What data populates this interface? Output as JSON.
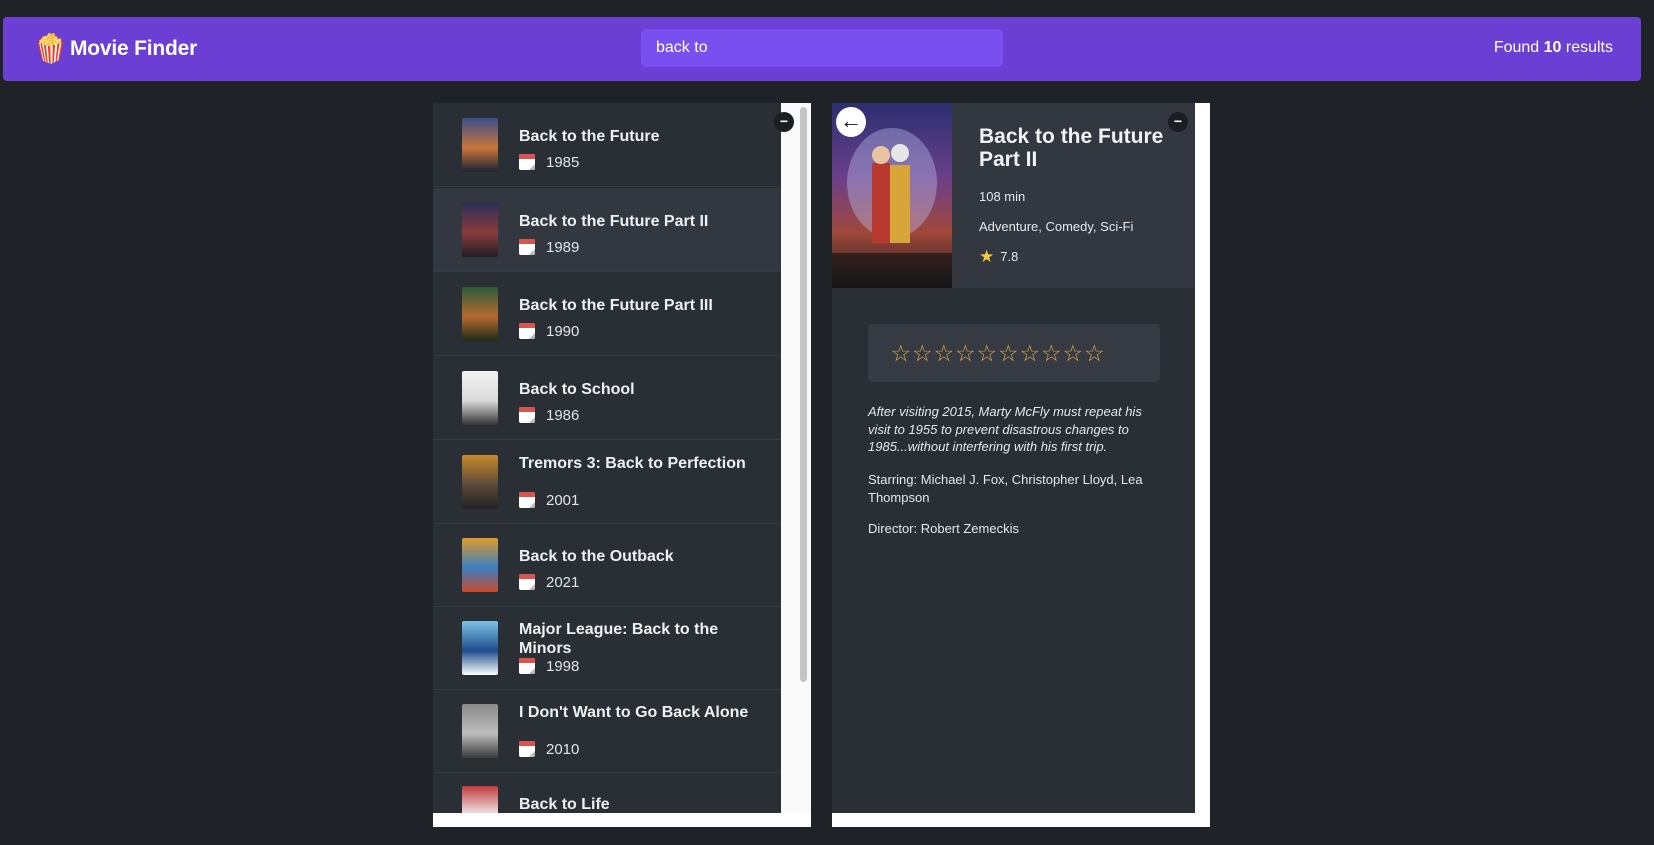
{
  "header": {
    "logo_icon": "popcorn-icon",
    "logo_glyph": "🍿",
    "title": "Movie Finder",
    "search_value": "back to",
    "result_prefix": "Found ",
    "result_count": "10",
    "result_suffix": " results"
  },
  "list": {
    "collapse_label": "−",
    "items": [
      {
        "title": "Back to the Future",
        "year": "1985",
        "poster_colors": [
          "#3a4d8a",
          "#c9753b",
          "#1d2235"
        ]
      },
      {
        "title": "Back to the Future Part II",
        "year": "1989",
        "poster_colors": [
          "#2b2f56",
          "#8a3b3b",
          "#1f1f25"
        ]
      },
      {
        "title": "Back to the Future Part III",
        "year": "1990",
        "poster_colors": [
          "#2b5a3a",
          "#b56a2f",
          "#1e2a1c"
        ]
      },
      {
        "title": "Back to School",
        "year": "1986",
        "poster_colors": [
          "#f4f4f4",
          "#d9d9d9",
          "#333333"
        ]
      },
      {
        "title": "Tremors 3: Back to Perfection",
        "year": "2001",
        "poster_colors": [
          "#c78a2c",
          "#5a4a3a",
          "#222222"
        ]
      },
      {
        "title": "Back to the Outback",
        "year": "2021",
        "poster_colors": [
          "#e09a2b",
          "#3a7fc2",
          "#c94a2b"
        ]
      },
      {
        "title": "Major League: Back to the Minors",
        "year": "1998",
        "poster_colors": [
          "#7fc2e6",
          "#1c4d8a",
          "#ffffff"
        ]
      },
      {
        "title": "I Don't Want to Go Back Alone",
        "year": "2010",
        "poster_colors": [
          "#8a8a8a",
          "#bdbdbd",
          "#3a3a3a"
        ]
      },
      {
        "title": "Back to Life",
        "year": "",
        "poster_colors": [
          "#c23a3a",
          "#f0f0f0",
          "#333333"
        ]
      }
    ]
  },
  "detail": {
    "back_label": "←",
    "collapse_label": "−",
    "title": "Back to the Future Part II",
    "runtime": "108 min",
    "genres": "Adventure, Comedy, Sci-Fi",
    "rating": "7.8",
    "user_stars": {
      "max": 10,
      "filled": 0
    },
    "plot": "After visiting 2015, Marty McFly must repeat his visit to 1955 to prevent disastrous changes to 1985...without interfering with his first trip.",
    "starring": "Starring: Michael J. Fox, Christopher Lloyd, Lea Thompson",
    "director": "Director: Robert Zemeckis"
  },
  "colors": {
    "accent": "#6b3fd4",
    "background": "#1f2328",
    "panel": "#2a2e35",
    "star": "#f5c842"
  }
}
